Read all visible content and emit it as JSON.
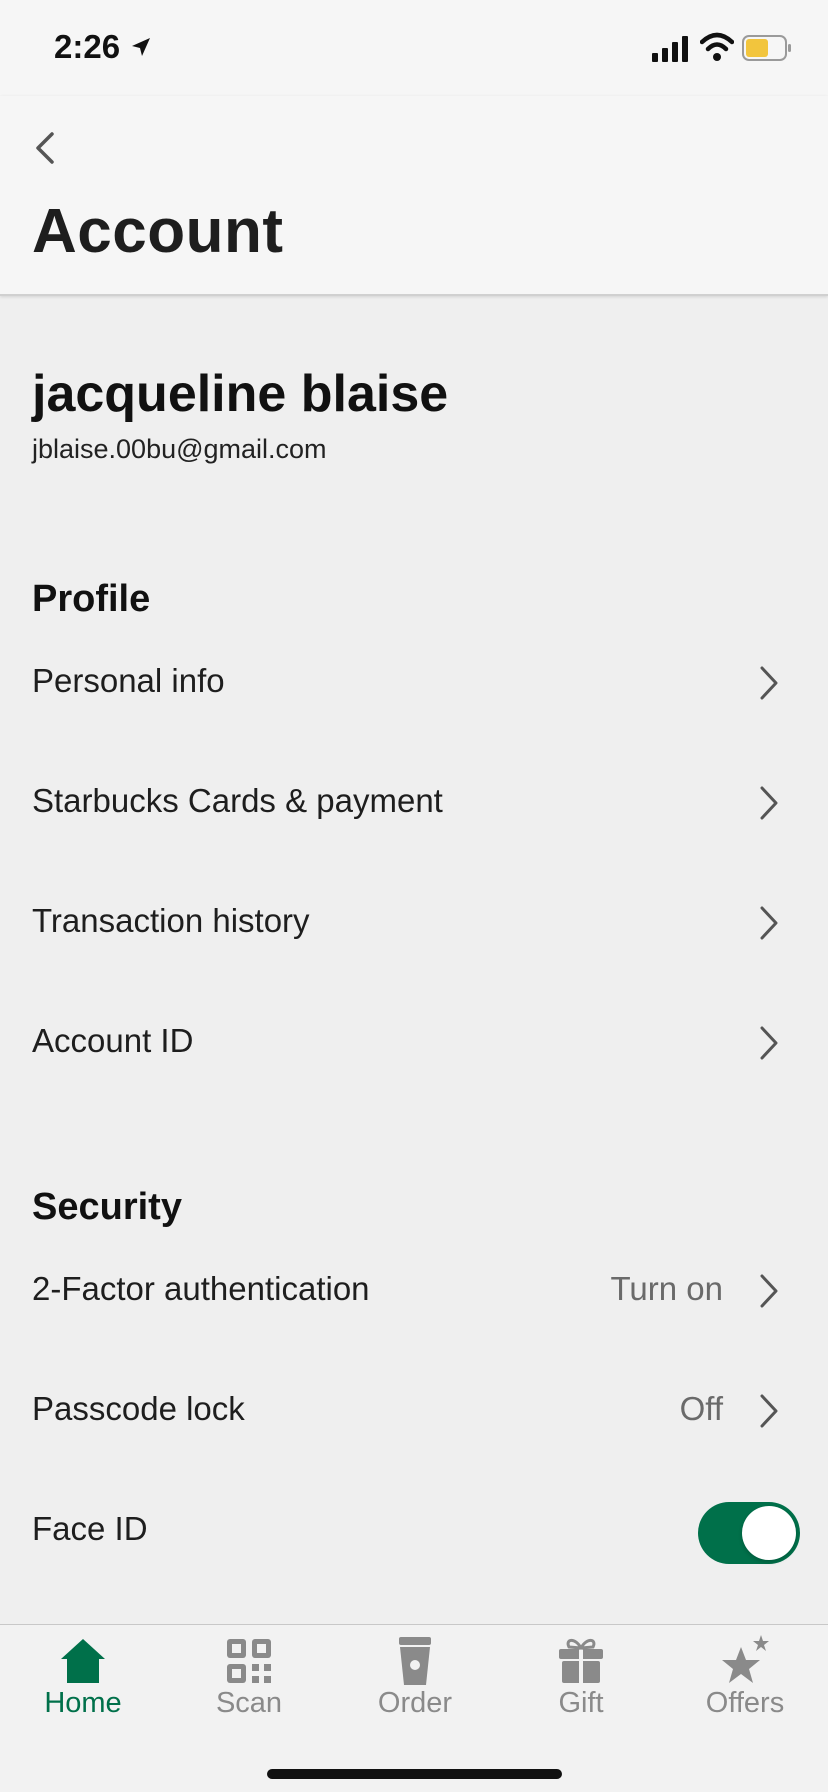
{
  "status_bar": {
    "time": "2:26"
  },
  "header": {
    "title": "Account"
  },
  "user": {
    "name": "jacqueline blaise",
    "email": "jblaise.00bu@gmail.com"
  },
  "profile": {
    "heading": "Profile",
    "items": [
      {
        "label": "Personal info"
      },
      {
        "label": "Starbucks Cards & payment"
      },
      {
        "label": "Transaction history"
      },
      {
        "label": "Account ID"
      }
    ]
  },
  "security": {
    "heading": "Security",
    "items": [
      {
        "label": "2-Factor authentication",
        "value": "Turn on"
      },
      {
        "label": "Passcode lock",
        "value": "Off"
      },
      {
        "label": "Face ID",
        "toggle_on": true
      }
    ]
  },
  "tabs": [
    {
      "label": "Home",
      "icon": "home-icon",
      "active": true
    },
    {
      "label": "Scan",
      "icon": "qr-code-icon",
      "active": false
    },
    {
      "label": "Order",
      "icon": "cup-icon",
      "active": false
    },
    {
      "label": "Gift",
      "icon": "gift-icon",
      "active": false
    },
    {
      "label": "Offers",
      "icon": "stars-icon",
      "active": false
    }
  ],
  "colors": {
    "accent": "#00704a",
    "inactive": "#8a8a8a",
    "battery": "#f2c53d"
  }
}
